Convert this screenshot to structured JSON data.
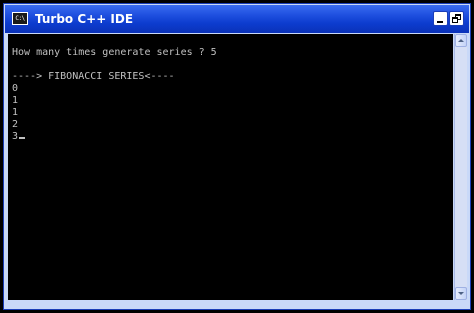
{
  "window": {
    "title": "Turbo C++ IDE",
    "app_icon_text": "C:\\",
    "icon": "console-app-icon",
    "controls": {
      "minimize_icon": "minimize-icon",
      "restore_icon": "restore-icon"
    }
  },
  "console": {
    "lines": [
      "How many times generate series ? 5",
      "",
      "----> FIBONACCI SERIES<----",
      "0",
      "1",
      "1",
      "2",
      "3"
    ],
    "text_color": "#c0c0c0",
    "background_color": "#000000"
  },
  "colors": {
    "titlebar": "#0d3ccf",
    "title_text": "#ffffff",
    "frame": "#c9d9f8"
  }
}
